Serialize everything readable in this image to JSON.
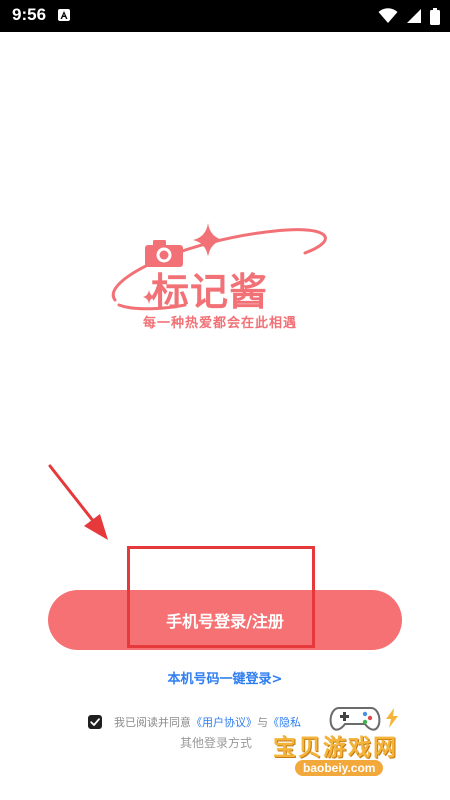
{
  "status_bar": {
    "time": "9:56",
    "icons": [
      "app-notification-icon",
      "wifi-icon",
      "cellular-signal-icon",
      "battery-icon"
    ]
  },
  "logo": {
    "wordmark": "标记酱",
    "slogan": "每一种热爱都会在此相遇",
    "color": "#f27176"
  },
  "login": {
    "primary_button_label": "手机号登录/注册",
    "one_click_label": "本机号码一键登录>",
    "agreement_prefix": "我已阅读并同意",
    "user_agreement": "《用户协议》",
    "connector": "与",
    "privacy_policy": "《隐私",
    "other_methods": "其他登录方式",
    "checkbox_checked": true
  },
  "watermark": {
    "title": "宝贝游戏网",
    "url": "baobeiy.com"
  },
  "colors": {
    "primary": "#f57174",
    "link": "#2f7ef0",
    "annotation": "#e5393b"
  }
}
